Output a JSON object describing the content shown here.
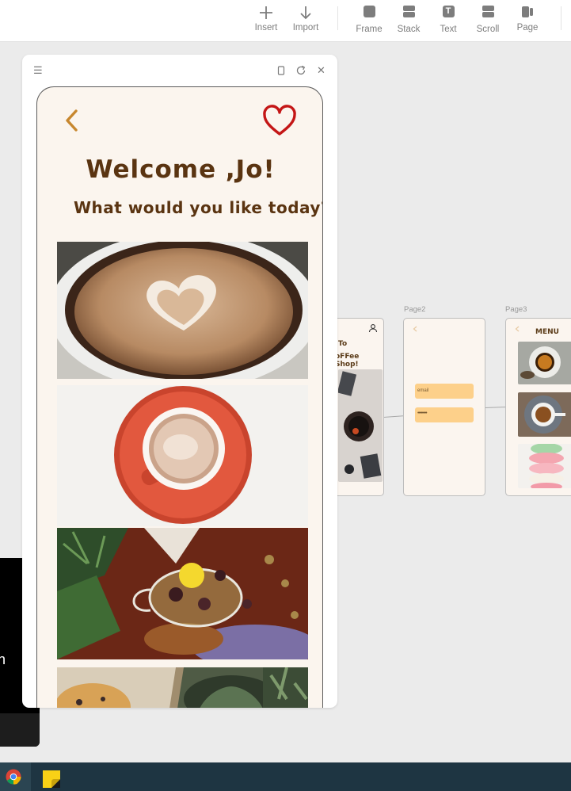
{
  "toolbar": {
    "tools": [
      {
        "label": "Insert",
        "icon": "plus-icon"
      },
      {
        "label": "Import",
        "icon": "arrow-down-icon"
      },
      {
        "label": "Frame",
        "icon": "frame-icon"
      },
      {
        "label": "Stack",
        "icon": "stack-icon"
      },
      {
        "label": "Text",
        "icon": "text-icon"
      },
      {
        "label": "Scroll",
        "icon": "scroll-icon"
      },
      {
        "label": "Page",
        "icon": "page-icon"
      }
    ],
    "text_icon_glyph": "T"
  },
  "preview": {
    "menu_icon": "☰",
    "close_icon": "✕",
    "app": {
      "welcome": "Welcome ,Jo!",
      "subtitle": "What would you like today?",
      "accent_back": "#c7872e",
      "accent_heart": "#c41616",
      "text_color": "#5a3411",
      "background": "#fbf5ee",
      "photos": [
        "latte-art-cup",
        "espresso-red-saucer",
        "herbal-tea-glass",
        "muffin-and-plants"
      ]
    }
  },
  "thumbnails": {
    "page1_partial": {
      "line1": "To",
      "line2": "oFFee Shop!"
    },
    "page2": {
      "label": "Page2",
      "email_placeholder": "email",
      "password_mask": "••••••••"
    },
    "page3": {
      "label": "Page3",
      "title": "MENU"
    }
  },
  "taskbar": {
    "apps": [
      "chrome-icon",
      "sticky-notes-icon"
    ],
    "background": "#1e3542"
  }
}
